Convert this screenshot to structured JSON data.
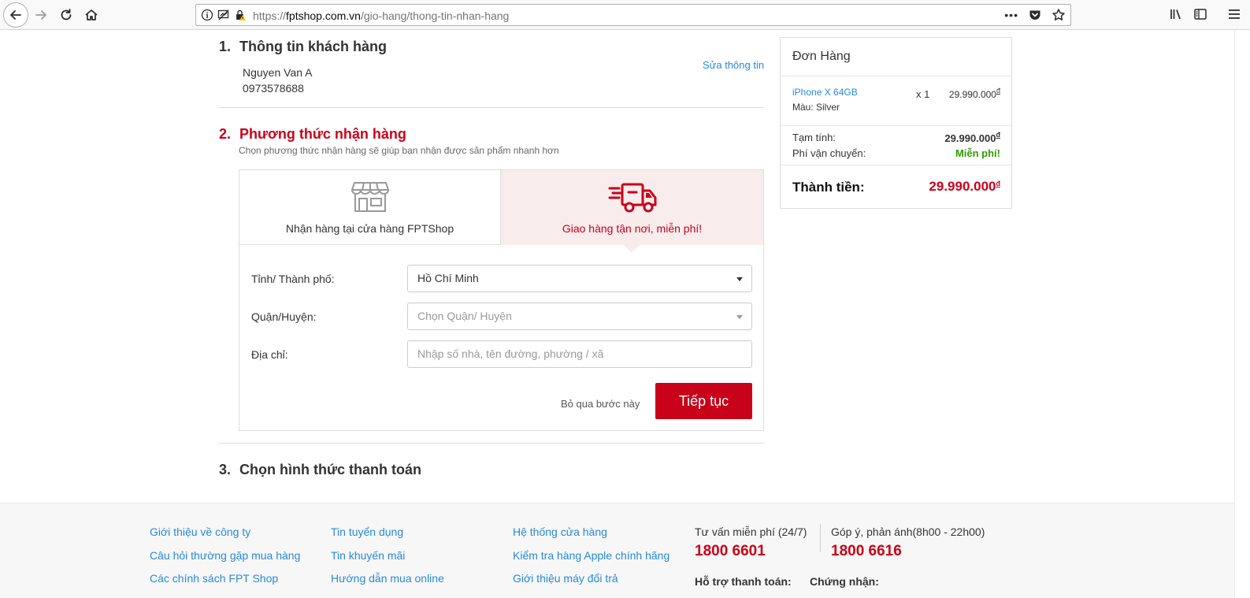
{
  "browser": {
    "url_prefix": "https://",
    "url_host": "fptshop.com.vn",
    "url_path": "/gio-hang/thong-tin-nhan-hang",
    "more_label": "•••"
  },
  "customer_section": {
    "number": "1.",
    "title": "Thông tin khách hàng",
    "name": "Nguyen Van A",
    "phone": "0973578688",
    "edit_label": "Sửa thông tin"
  },
  "delivery_section": {
    "number": "2.",
    "title": "Phương thức nhận hàng",
    "note": "Chọn phương thức nhận hàng sẽ giúp bạn nhận được sản phẩm nhanh hơn",
    "options": [
      {
        "label": "Nhận hàng tại cửa hàng FPTShop",
        "icon": "store-icon",
        "selected": false
      },
      {
        "label": "Giao hàng tận nơi, miễn phí!",
        "icon": "delivery-truck-icon",
        "selected": true
      }
    ],
    "form": {
      "city_label": "Tỉnh/ Thành phố:",
      "city_value": "Hồ Chí Minh",
      "district_label": "Quận/Huyện:",
      "district_placeholder": "Chọn Quận/ Huyện",
      "address_label": "Địa chỉ:",
      "address_placeholder": "Nhập số nhà, tên đường, phường / xã"
    },
    "skip_label": "Bỏ qua bước này",
    "continue_label": "Tiếp tục"
  },
  "payment_section": {
    "number": "3.",
    "title": "Chọn hình thức thanh toán"
  },
  "order": {
    "title": "Đơn Hàng",
    "item": {
      "name": "iPhone X 64GB",
      "color_label": "Màu: Silver",
      "qty": "x 1",
      "price": "29.990.000"
    },
    "subtotal_label": "Tạm tính:",
    "subtotal_value": "29.990.000",
    "shipping_label": "Phí vận chuyển:",
    "shipping_value": "Miễn phí!",
    "total_label": "Thành tiền:",
    "total_value": "29.990.000",
    "currency": "đ"
  },
  "footer": {
    "col1": [
      "Giới thiệu về công ty",
      "Câu hỏi thường gặp mua hàng",
      "Các chính sách FPT Shop"
    ],
    "col2": [
      "Tin tuyển dụng",
      "Tin khuyến mãi",
      "Hướng dẫn mua online"
    ],
    "col3": [
      "Hệ thống cửa hàng",
      "Kiểm tra hàng Apple chính hãng",
      "Giới thiệu máy đổi trả"
    ],
    "hotline1_label": "Tư vấn miễn phí (24/7)",
    "hotline1_number": "1800 6601",
    "hotline2_label": "Góp ý, phản ánh(8h00 - 22h00)",
    "hotline2_number": "1800 6616",
    "payment_support_label": "Hỗ trợ thanh toán:",
    "certification_label": "Chứng nhận:"
  },
  "colors": {
    "brand_red": "#c80219",
    "link_blue": "#288ad6",
    "free_green": "#2f9e00",
    "selected_bg": "#f8eced"
  }
}
